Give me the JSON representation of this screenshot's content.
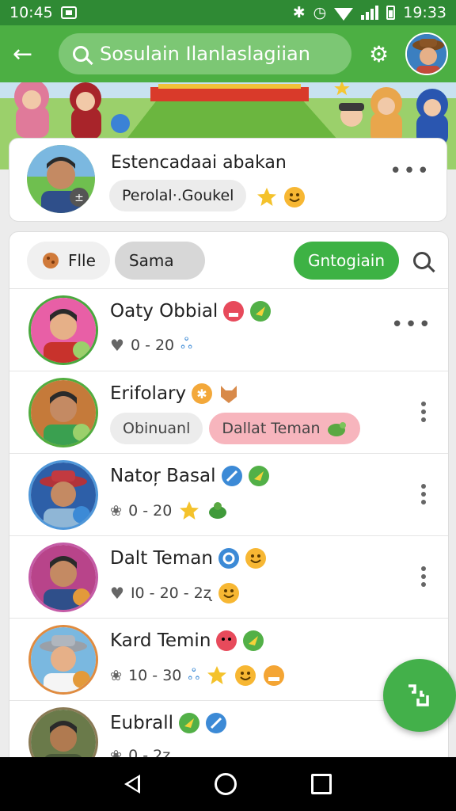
{
  "status": {
    "time_left": "10:45",
    "time_right": "19:33"
  },
  "appbar": {
    "search_text": "Sosulain Ilanlaslagiian"
  },
  "profile": {
    "name": "Estencadaai abakan",
    "chip": "Perolal·.Goukel"
  },
  "filters": {
    "file": "Flle",
    "sama": "Sama",
    "action": "Gntogiain"
  },
  "contacts": [
    {
      "name": "Oaty Obbial",
      "meta": "0 - 20",
      "ring": "#49a83d"
    },
    {
      "name": "Erifolary",
      "chip_a": "Obinuanl",
      "chip_b": "Dallat Teman",
      "ring": "#52ad3f"
    },
    {
      "name": "Natoŗ Basal",
      "meta": "0 - 20",
      "ring": "#4f97d9"
    },
    {
      "name": "Dalt Teman",
      "meta": "I0 - 20 - 2ʐ",
      "ring": "#c45ba6"
    },
    {
      "name": "Kard Temin",
      "meta": "10 - 30",
      "ring": "#e08b3f"
    },
    {
      "name": "Eubrall",
      "meta": "0 - 2ʐ",
      "ring": "#8a7a55"
    }
  ],
  "colors": {
    "primary": "#4caf43",
    "status": "#2f8a34",
    "accent_chip": "#f7b5bd"
  }
}
